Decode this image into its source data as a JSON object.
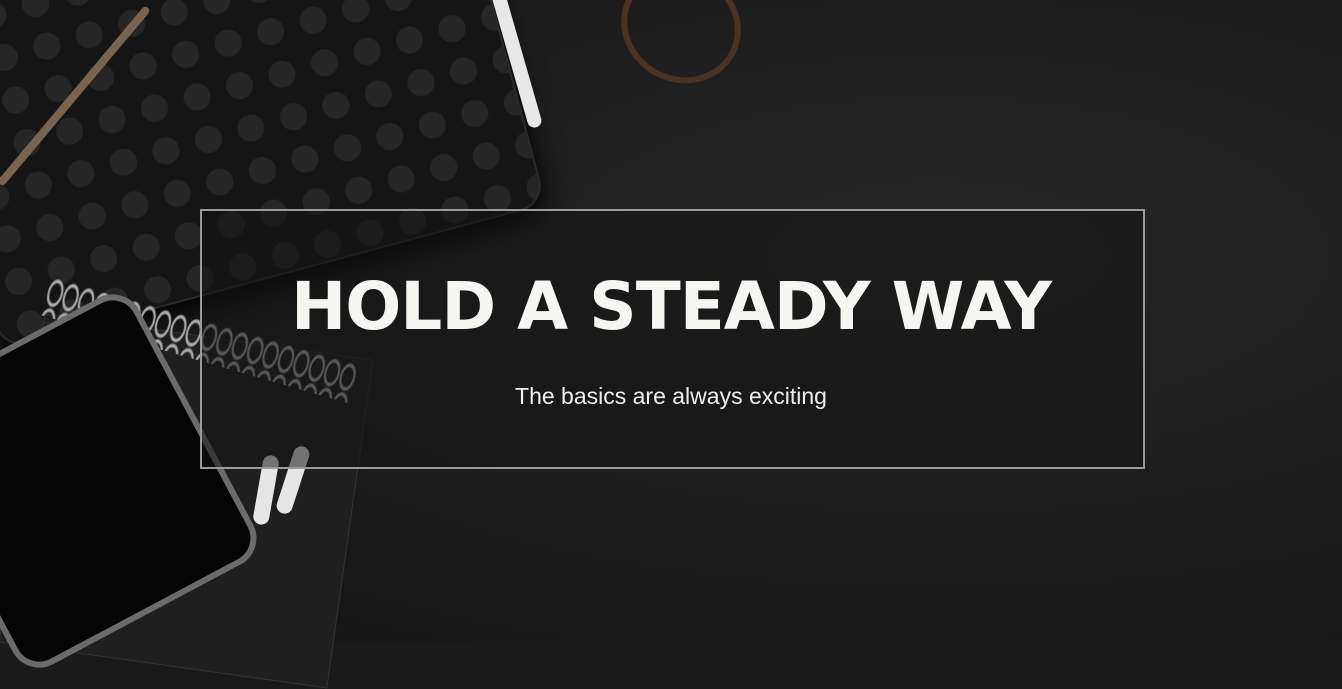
{
  "slide": {
    "title": "HOLD A STEADY WAY",
    "subtitle": "The basics are always exciting"
  },
  "colors": {
    "background": "#1c1c1c",
    "text": "#f5f5f2",
    "frame_border": "#9a9a9a"
  }
}
